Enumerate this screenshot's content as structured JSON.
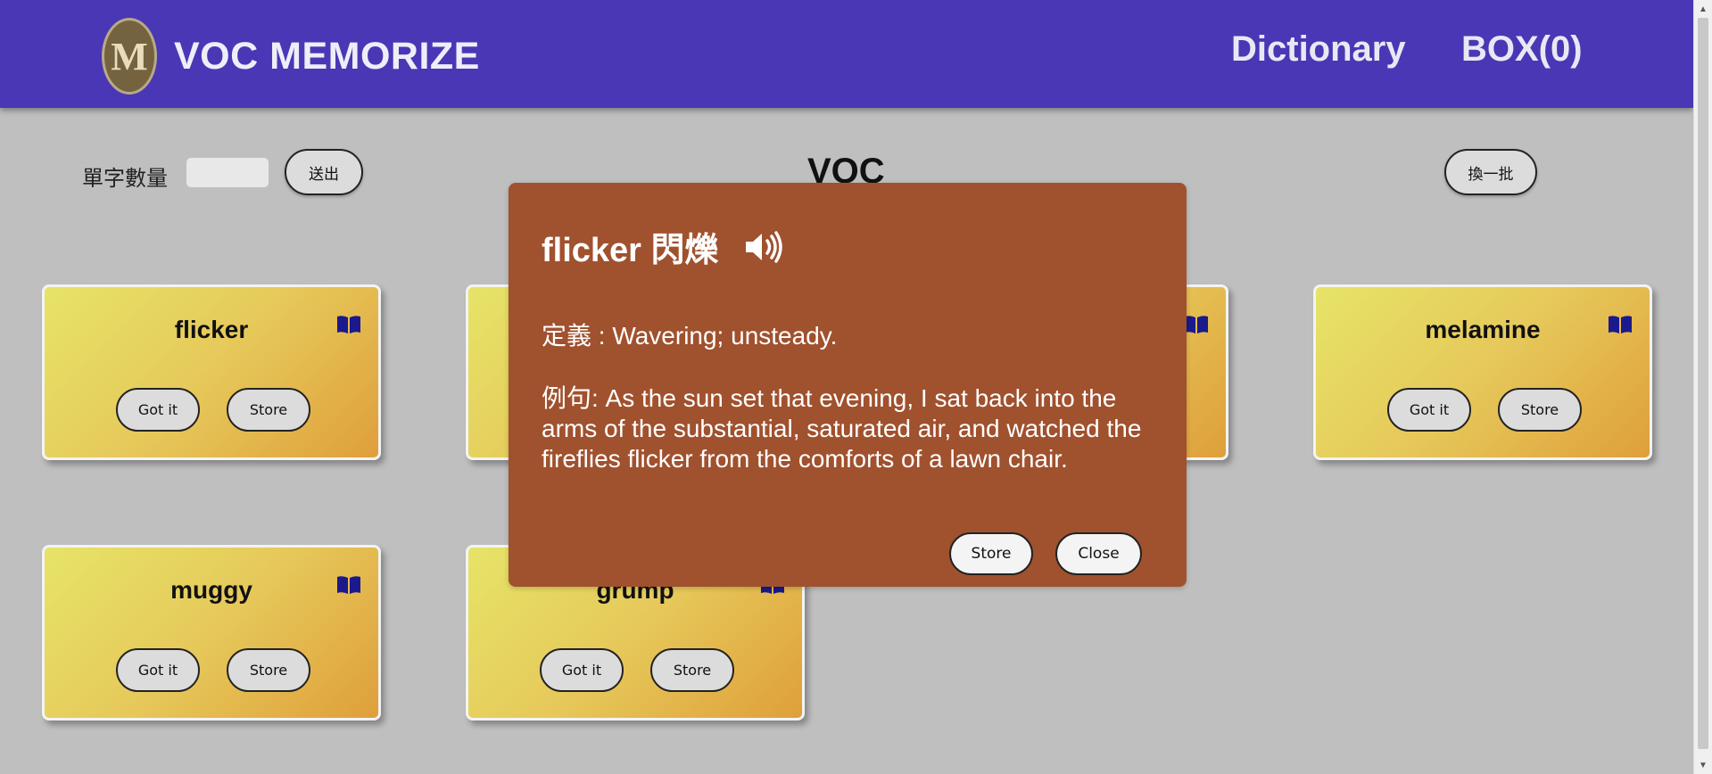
{
  "header": {
    "logo_letter": "M",
    "brand": "VOC MEMORIZE",
    "nav": {
      "dictionary": "Dictionary",
      "box": "BOX(0)"
    }
  },
  "controls": {
    "count_label": "單字數量",
    "count_value": "",
    "submit_label": "送出",
    "refresh_label": "換一批"
  },
  "page_title": "VOC",
  "cards": [
    {
      "word": "flicker",
      "got_label": "Got it",
      "store_label": "Store"
    },
    {
      "word": "",
      "got_label": "",
      "store_label": ""
    },
    {
      "word": "",
      "got_label": "",
      "store_label": ""
    },
    {
      "word": "melamine",
      "got_label": "Got it",
      "store_label": "Store"
    },
    {
      "word": "muggy",
      "got_label": "Got it",
      "store_label": "Store"
    },
    {
      "word": "grump",
      "got_label": "Got it",
      "store_label": "Store"
    }
  ],
  "modal": {
    "title": "flicker 閃爍",
    "definition": "定義 : Wavering; unsteady.",
    "example": "例句: As the sun set that evening, I sat back into the arms of the substantial, saturated air, and watched the fireflies flicker from the comforts of a lawn chair.",
    "store_label": "Store",
    "close_label": "Close"
  },
  "icons": {
    "card_icon": "book-icon",
    "modal_icon": "speaker-icon"
  },
  "colors": {
    "header_bg": "#4a37b5",
    "page_bg": "#bfbfbf",
    "modal_bg": "#a0512e",
    "book_icon": "#1a1a8c"
  }
}
